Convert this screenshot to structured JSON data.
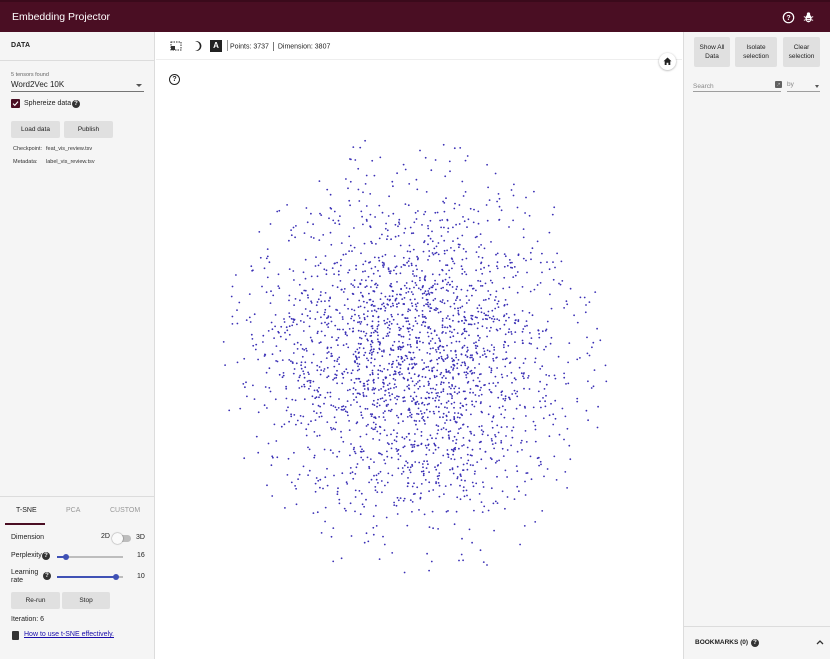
{
  "app": {
    "title": "Embedding Projector"
  },
  "colors": {
    "brand": "#4a0e23",
    "point": "#3a2fb5",
    "accent": "#3f51b5"
  },
  "left_panel": {
    "data_title": "DATA",
    "tensors_found": "5 tensors found",
    "tensor_selected": "Word2Vec 10K",
    "sphereize_label": "Sphereize data",
    "sphereize_checked": true,
    "load_button": "Load data",
    "publish_button": "Publish",
    "checkpoint_label": "Checkpoint:",
    "checkpoint_value": "feat_vis_review.tsv",
    "metadata_label": "Metadata:",
    "metadata_value": "label_vis_review.tsv",
    "tabs": [
      "T-SNE",
      "PCA",
      "CUSTOM"
    ],
    "active_tab": "T-SNE",
    "dimension_label": "Dimension",
    "dimension_2d": "2D",
    "dimension_3d": "3D",
    "perplexity_label": "Perplexity",
    "perplexity_value": "16",
    "perplexity_fraction": 0.13,
    "learning_rate_label": "Learning rate",
    "learning_rate_value": "10",
    "learning_rate_fraction": 0.9,
    "rerun_button": "Re-run",
    "stop_button": "Stop",
    "iteration_text": "Iteration: 6",
    "tsne_link": "How to use t-SNE effectively."
  },
  "toolbar": {
    "points_text": "Points: 3737",
    "dimension_text": "Dimension: 3807"
  },
  "right_panel": {
    "show_all": "Show All Data",
    "isolate": "Isolate selection",
    "clear": "Clear selection",
    "search_placeholder": "Search",
    "regex_glyph": ".*",
    "by_label": "by",
    "bookmarks": "BOOKMARKS (0)"
  },
  "icons": {
    "help": "help-circle-icon",
    "bug": "bug-icon",
    "selection": "selection-box-icon",
    "night_mode": "moon-icon",
    "labels": "label-A-icon",
    "home": "home-icon",
    "book": "book-icon",
    "chevron": "chevron-up-icon"
  }
}
